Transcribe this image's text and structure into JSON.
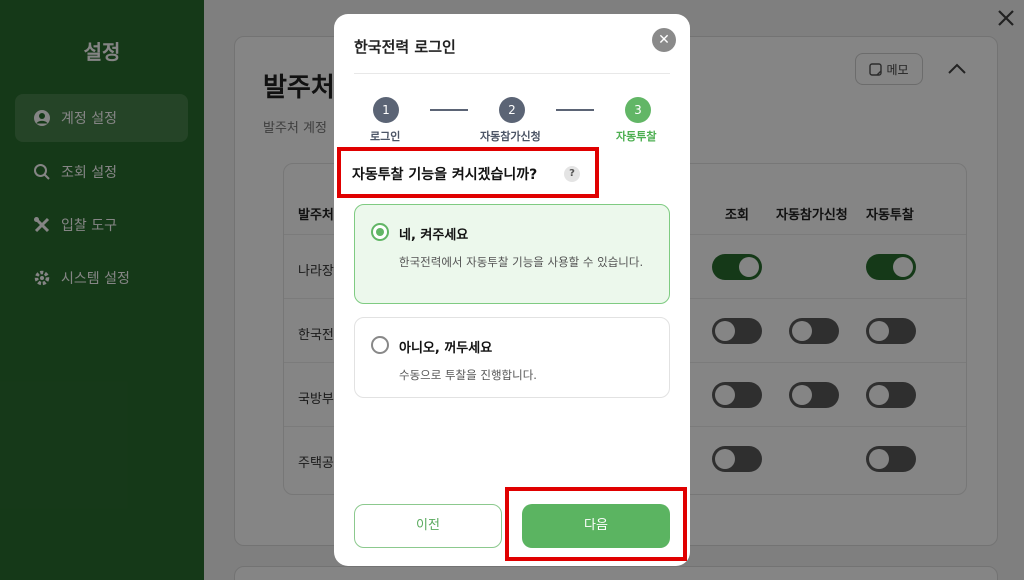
{
  "sidebar": {
    "title": "설정",
    "items": [
      {
        "label": "계정 설정",
        "icon": "user-circle-icon"
      },
      {
        "label": "조회 설정",
        "icon": "search-icon"
      },
      {
        "label": "입찰 도구",
        "icon": "tools-icon"
      },
      {
        "label": "시스템 설정",
        "icon": "gear-icon"
      }
    ]
  },
  "main": {
    "title": "발주처",
    "subtitle": "발주처 계정",
    "memo_label": "메모",
    "columns": [
      "발주처",
      "조회",
      "자동참가신청",
      "자동투찰"
    ],
    "rows": [
      {
        "label": "나라장",
        "view": true,
        "auto_join": null,
        "auto_bid": true
      },
      {
        "label": "한국전",
        "view": false,
        "auto_join": false,
        "auto_bid": false
      },
      {
        "label": "국방부",
        "view": false,
        "auto_join": false,
        "auto_bid": false
      },
      {
        "label": "주택공",
        "view": false,
        "auto_join": null,
        "auto_bid": false
      }
    ]
  },
  "modal": {
    "title": "한국전력 로그인",
    "steps": [
      {
        "number": "1",
        "label": "로그인"
      },
      {
        "number": "2",
        "label": "자동참가신청"
      },
      {
        "number": "3",
        "label": "자동투찰"
      }
    ],
    "question": "자동투찰 기능을 켜시겠습니까?",
    "help_glyph": "?",
    "options": [
      {
        "title": "네, 켜주세요",
        "desc": "한국전력에서 자동투찰 기능을 사용할 수 있습니다.",
        "selected": true
      },
      {
        "title": "아니오, 꺼두세요",
        "desc": "수동으로 투찰을 진행합니다.",
        "selected": false
      }
    ],
    "prev_label": "이전",
    "next_label": "다음"
  },
  "colors": {
    "sidebar_bg": "#2a6e2f",
    "accent": "#5bb461",
    "step_inactive": "#5b6475",
    "highlight": "#e00000"
  }
}
